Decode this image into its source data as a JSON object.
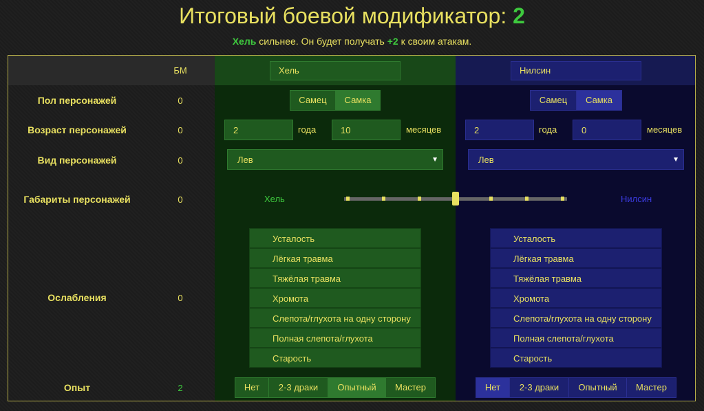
{
  "header": {
    "title_prefix": "Итоговый боевой модификатор:",
    "title_value": "2",
    "subtitle_name": "Хель",
    "subtitle_mid": " сильнее. Он будет получать ",
    "subtitle_bonus": "+2",
    "subtitle_tail": " к своим атакам."
  },
  "columns": {
    "bm": "БМ",
    "left_name": "Хель",
    "right_name": "Нилсин"
  },
  "rows": {
    "gender": {
      "label": "Пол персонажей",
      "bm": "0",
      "male": "Самец",
      "female": "Самка",
      "left_selected": "Самка",
      "right_selected": "Самка"
    },
    "age": {
      "label": "Возраст персонажей",
      "bm": "0",
      "left_years": "2",
      "left_months": "10",
      "right_years": "2",
      "right_months": "0",
      "years_word": "года",
      "months_word": "месяцев"
    },
    "species": {
      "label": "Вид персонажей",
      "bm": "0",
      "left": "Лев",
      "right": "Лев"
    },
    "size": {
      "label": "Габариты персонажей",
      "bm": "0",
      "left_label": "Хель",
      "right_label": "Нилсин",
      "slider_position": 0.5
    },
    "weakness": {
      "label": "Ослабления",
      "bm": "0",
      "items": [
        "Усталость",
        "Лёгкая травма",
        "Тяжёлая травма",
        "Хромота",
        "Слепота/глухота на одну сторону",
        "Полная слепота/глухота",
        "Старость"
      ]
    },
    "experience": {
      "label": "Опыт",
      "bm": "2",
      "options": [
        "Нет",
        "2-3 драки",
        "Опытный",
        "Мастер"
      ],
      "left_selected": "Опытный",
      "right_selected": "Нет"
    }
  },
  "colors": {
    "accent_yellow": "#e8e060",
    "green": "#3ec93e",
    "blue_text": "#3b3be0"
  }
}
